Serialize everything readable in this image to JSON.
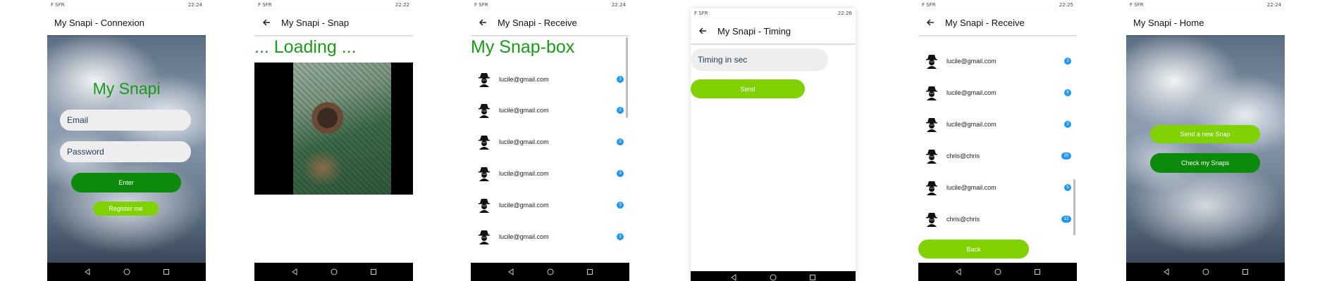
{
  "status": {
    "carrier": "F SFR",
    "times": [
      "22:24",
      "22:22",
      "22:24",
      "22:26",
      "22:25",
      "22:24"
    ]
  },
  "screen1": {
    "title": "My Snapi - Connexion",
    "heading": "My Snapi",
    "email_placeholder": "Email",
    "password_placeholder": "Password",
    "enter_label": "Enter",
    "register_label": "Register me"
  },
  "screen2": {
    "title": "My Snapi - Snap",
    "loading": "... Loading ..."
  },
  "screen3": {
    "title": "My Snapi - Receive",
    "heading": "My Snap-box",
    "rows": [
      {
        "email": "lucile@gmail.com",
        "count": "3"
      },
      {
        "email": "lucile@gmail.com",
        "count": "2"
      },
      {
        "email": "lucile@gmail.com",
        "count": "3"
      },
      {
        "email": "lucile@gmail.com",
        "count": "3"
      },
      {
        "email": "lucile@gmail.com",
        "count": "3"
      },
      {
        "email": "lucile@gmail.com",
        "count": "3"
      }
    ]
  },
  "screen4": {
    "title": "My Snapi - Timing",
    "timing_placeholder": "Timing in sec",
    "send_label": "Send"
  },
  "screen5": {
    "title": "My Snapi - Receive",
    "rows": [
      {
        "email": "lucile@gmail.com",
        "count": "3"
      },
      {
        "email": "lucile@gmail.com",
        "count": "6"
      },
      {
        "email": "lucile@gmail.com",
        "count": "3"
      },
      {
        "email": "chris@chris",
        "count": "20"
      },
      {
        "email": "lucile@gmail.com",
        "count": "5"
      },
      {
        "email": "chris@chris",
        "count": "12"
      }
    ],
    "back_label": "Back"
  },
  "screen6": {
    "title": "My Snapi - Home",
    "send_new_label": "Send a new Snap",
    "check_label": "Check my Snaps"
  },
  "colors": {
    "brand_green": "#0b8a0b",
    "lime": "#7fd100",
    "heading_green": "#1a9a1a",
    "badge_blue": "#2196f3"
  },
  "icons": [
    "back-arrow-icon",
    "spy-avatar-icon",
    "nav-back-icon",
    "nav-home-icon",
    "nav-recents-icon"
  ]
}
